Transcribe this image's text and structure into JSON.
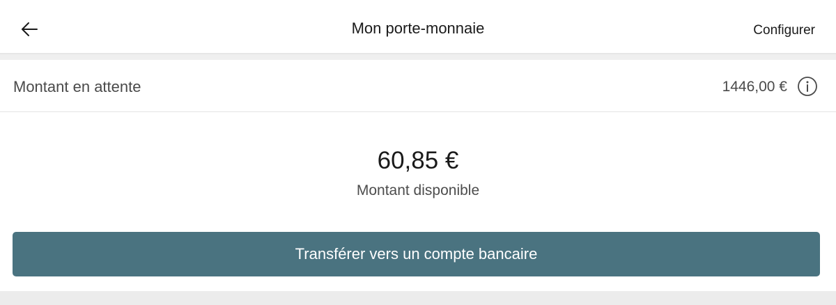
{
  "header": {
    "title": "Mon porte-monnaie",
    "configure_label": "Configurer",
    "back_icon": "arrow-left-icon"
  },
  "pending": {
    "label": "Montant en attente",
    "amount": "1446,00 €",
    "info_icon": "info-icon"
  },
  "available": {
    "amount": "60,85 €",
    "label": "Montant disponible"
  },
  "actions": {
    "transfer_label": "Transférer vers un compte bancaire"
  },
  "colors": {
    "primary_button": "#4a7380",
    "background": "#ededed",
    "surface": "#ffffff"
  }
}
